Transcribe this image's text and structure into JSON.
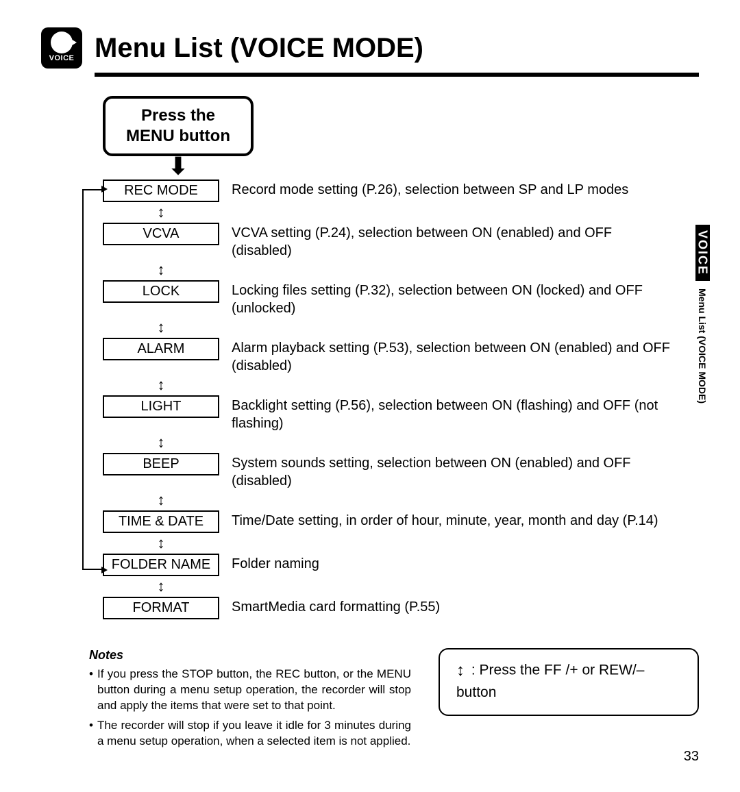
{
  "header": {
    "icon_label": "VOICE",
    "title": "Menu List (VOICE MODE)"
  },
  "start_box": {
    "line1": "Press the",
    "line2": "MENU button"
  },
  "menu_items": [
    {
      "label": "REC MODE",
      "desc": "Record mode setting (P.26), selection between SP and LP modes"
    },
    {
      "label": "VCVA",
      "desc": "VCVA setting (P.24), selection between ON (enabled) and OFF (disabled)"
    },
    {
      "label": "LOCK",
      "desc": "Locking files setting (P.32), selection between ON (locked) and OFF (unlocked)"
    },
    {
      "label": "ALARM",
      "desc": "Alarm playback setting (P.53), selection between ON (enabled) and OFF (disabled)"
    },
    {
      "label": "LIGHT",
      "desc": "Backlight setting (P.56), selection between ON (flashing) and OFF (not flashing)"
    },
    {
      "label": "BEEP",
      "desc": "System sounds setting, selection between ON (enabled) and OFF (disabled)"
    },
    {
      "label": "TIME & DATE",
      "desc": "Time/Date setting, in order of hour, minute, year, month and day (P.14)"
    },
    {
      "label": "FOLDER NAME",
      "desc": "Folder naming"
    },
    {
      "label": "FORMAT",
      "desc": "SmartMedia card formatting (P.55)"
    }
  ],
  "updown_symbol": "↕",
  "down_arrow_symbol": "⬇",
  "notes": {
    "heading": "Notes",
    "items": [
      "If you press the STOP button, the REC button, or the MENU button during a menu setup operation, the recorder will stop and apply the items that were set to that point.",
      "The recorder will stop if you leave it idle for 3 minutes during a menu setup operation, when a selected item is not applied."
    ]
  },
  "legend": {
    "symbol": "↕",
    "text": ": Press the FF /+ or REW/– button"
  },
  "side_tab": {
    "black": "VOICE",
    "rest": "Menu List (VOICE MODE)"
  },
  "page_number": "33"
}
